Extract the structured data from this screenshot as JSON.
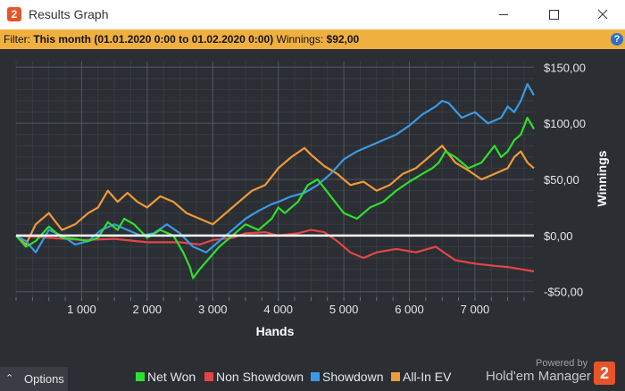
{
  "window": {
    "title": "Results Graph",
    "app_icon_glyph": "2"
  },
  "filter": {
    "label": "Filter:",
    "value": "This month (01.01.2020 0:00 to 01.02.2020 0:00)",
    "winnings_label": "Winnings:",
    "winnings_value": "$92,00",
    "help_glyph": "?"
  },
  "chart_data": {
    "type": "line",
    "xlabel": "Hands",
    "ylabel": "Winnings",
    "xlim": [
      0,
      7900
    ],
    "ylim": [
      -55,
      155
    ],
    "x_ticks": [
      1000,
      2000,
      3000,
      4000,
      5000,
      6000,
      7000
    ],
    "x_tick_labels": [
      "1 000",
      "2 000",
      "3 000",
      "4 000",
      "5 000",
      "6 000",
      "7 000"
    ],
    "y_ticks": [
      150,
      100,
      50,
      0,
      -50
    ],
    "y_tick_labels": [
      "$150,00",
      "$100,00",
      "$50,00",
      "$0,00",
      "-$50,00"
    ],
    "grid": true,
    "legend_position": "bottom",
    "series": [
      {
        "name": "Net Won",
        "color": "#2ee02e",
        "x": [
          0,
          150,
          300,
          500,
          700,
          900,
          1100,
          1250,
          1400,
          1550,
          1650,
          1800,
          2000,
          2200,
          2400,
          2550,
          2650,
          2700,
          2800,
          2950,
          3100,
          3300,
          3500,
          3700,
          3900,
          4000,
          4100,
          4300,
          4450,
          4600,
          4800,
          5000,
          5200,
          5400,
          5600,
          5800,
          6000,
          6200,
          6350,
          6450,
          6550,
          6700,
          6900,
          7100,
          7300,
          7400,
          7500,
          7600,
          7700,
          7800,
          7900
        ],
        "values": [
          0,
          -10,
          -5,
          8,
          -2,
          -3,
          -5,
          -2,
          12,
          5,
          15,
          10,
          -2,
          5,
          0,
          -15,
          -28,
          -38,
          -30,
          -20,
          -10,
          0,
          10,
          5,
          15,
          25,
          20,
          30,
          45,
          50,
          35,
          20,
          15,
          25,
          30,
          40,
          48,
          55,
          60,
          65,
          75,
          70,
          60,
          65,
          80,
          70,
          75,
          85,
          90,
          105,
          95
        ]
      },
      {
        "name": "Non Showdown",
        "color": "#e64545",
        "x": [
          0,
          500,
          1000,
          1500,
          2000,
          2500,
          2800,
          3000,
          3300,
          3500,
          3800,
          4000,
          4300,
          4500,
          4700,
          4900,
          5100,
          5300,
          5500,
          5800,
          6100,
          6400,
          6700,
          7000,
          7300,
          7500,
          7700,
          7900
        ],
        "values": [
          0,
          -2,
          -4,
          -3,
          -6,
          -6,
          -8,
          -4,
          -2,
          2,
          3,
          0,
          2,
          5,
          3,
          -5,
          -15,
          -20,
          -15,
          -12,
          -15,
          -10,
          -22,
          -25,
          -27,
          -28,
          -30,
          -32
        ]
      },
      {
        "name": "Showdown",
        "color": "#3a9ae6",
        "x": [
          0,
          150,
          300,
          500,
          700,
          900,
          1100,
          1300,
          1500,
          1700,
          1900,
          2100,
          2300,
          2500,
          2700,
          2900,
          3100,
          3300,
          3500,
          3700,
          3900,
          4000,
          4200,
          4400,
          4600,
          4800,
          5000,
          5200,
          5400,
          5600,
          5800,
          6000,
          6200,
          6400,
          6500,
          6600,
          6800,
          7000,
          7200,
          7400,
          7500,
          7600,
          7700,
          7800,
          7900
        ],
        "values": [
          0,
          -5,
          -15,
          5,
          0,
          -8,
          -5,
          5,
          10,
          5,
          0,
          2,
          10,
          2,
          -10,
          -15,
          -5,
          5,
          15,
          22,
          28,
          30,
          35,
          38,
          45,
          55,
          68,
          75,
          80,
          85,
          90,
          98,
          108,
          115,
          120,
          118,
          105,
          110,
          100,
          105,
          115,
          110,
          120,
          135,
          125
        ]
      },
      {
        "name": "All-In EV",
        "color": "#f09a38",
        "x": [
          0,
          150,
          300,
          500,
          700,
          900,
          1100,
          1250,
          1400,
          1550,
          1700,
          1850,
          2000,
          2200,
          2400,
          2600,
          2800,
          3000,
          3200,
          3400,
          3600,
          3800,
          4000,
          4200,
          4400,
          4500,
          4700,
          4900,
          5100,
          5300,
          5500,
          5700,
          5900,
          6100,
          6300,
          6500,
          6700,
          6900,
          7100,
          7300,
          7500,
          7600,
          7700,
          7800,
          7900
        ],
        "values": [
          0,
          -8,
          10,
          20,
          5,
          10,
          20,
          25,
          40,
          30,
          38,
          30,
          25,
          35,
          30,
          20,
          15,
          10,
          20,
          30,
          40,
          45,
          60,
          70,
          78,
          72,
          62,
          55,
          45,
          48,
          40,
          45,
          55,
          60,
          70,
          80,
          65,
          58,
          50,
          55,
          60,
          70,
          75,
          65,
          60
        ]
      }
    ]
  },
  "options": {
    "label": "Options",
    "caret": "⌃"
  },
  "legend": [
    {
      "label": "Net Won",
      "color": "#2ee02e"
    },
    {
      "label": "Non Showdown",
      "color": "#e64545"
    },
    {
      "label": "Showdown",
      "color": "#3a9ae6"
    },
    {
      "label": "All-In EV",
      "color": "#f09a38"
    }
  ],
  "branding": {
    "powered_by": "Powered by",
    "product": "Hold'em Manager",
    "logo_glyph": "2"
  }
}
